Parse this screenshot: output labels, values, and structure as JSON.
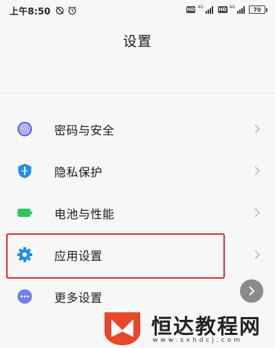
{
  "status_bar": {
    "time": "上午8:50",
    "battery": "70",
    "network_label": "HD",
    "network_type": "4G",
    "icons": [
      "alarm-off-icon",
      "alarm-clock-icon",
      "hd-icon",
      "signal-icon",
      "battery-icon"
    ]
  },
  "page": {
    "title": "设置"
  },
  "items": [
    {
      "label": "密码与安全",
      "icon": "fingerprint-icon",
      "color": "#5a63e8"
    },
    {
      "label": "隐私保护",
      "icon": "privacy-shield-icon",
      "color": "#1c8fe6"
    },
    {
      "label": "电池与性能",
      "icon": "battery-icon",
      "color": "#2ec55a"
    },
    {
      "label": "应用设置",
      "icon": "gear-icon",
      "color": "#1f8fe4",
      "highlighted": true
    },
    {
      "label": "更多设置",
      "icon": "more-dots-icon",
      "color": "#6f7df0"
    }
  ],
  "highlight_color": "#e0202a",
  "watermark": {
    "name": "恒达教程网",
    "url": "www.sxhdcj.com",
    "logo_color": "#e8472a"
  }
}
